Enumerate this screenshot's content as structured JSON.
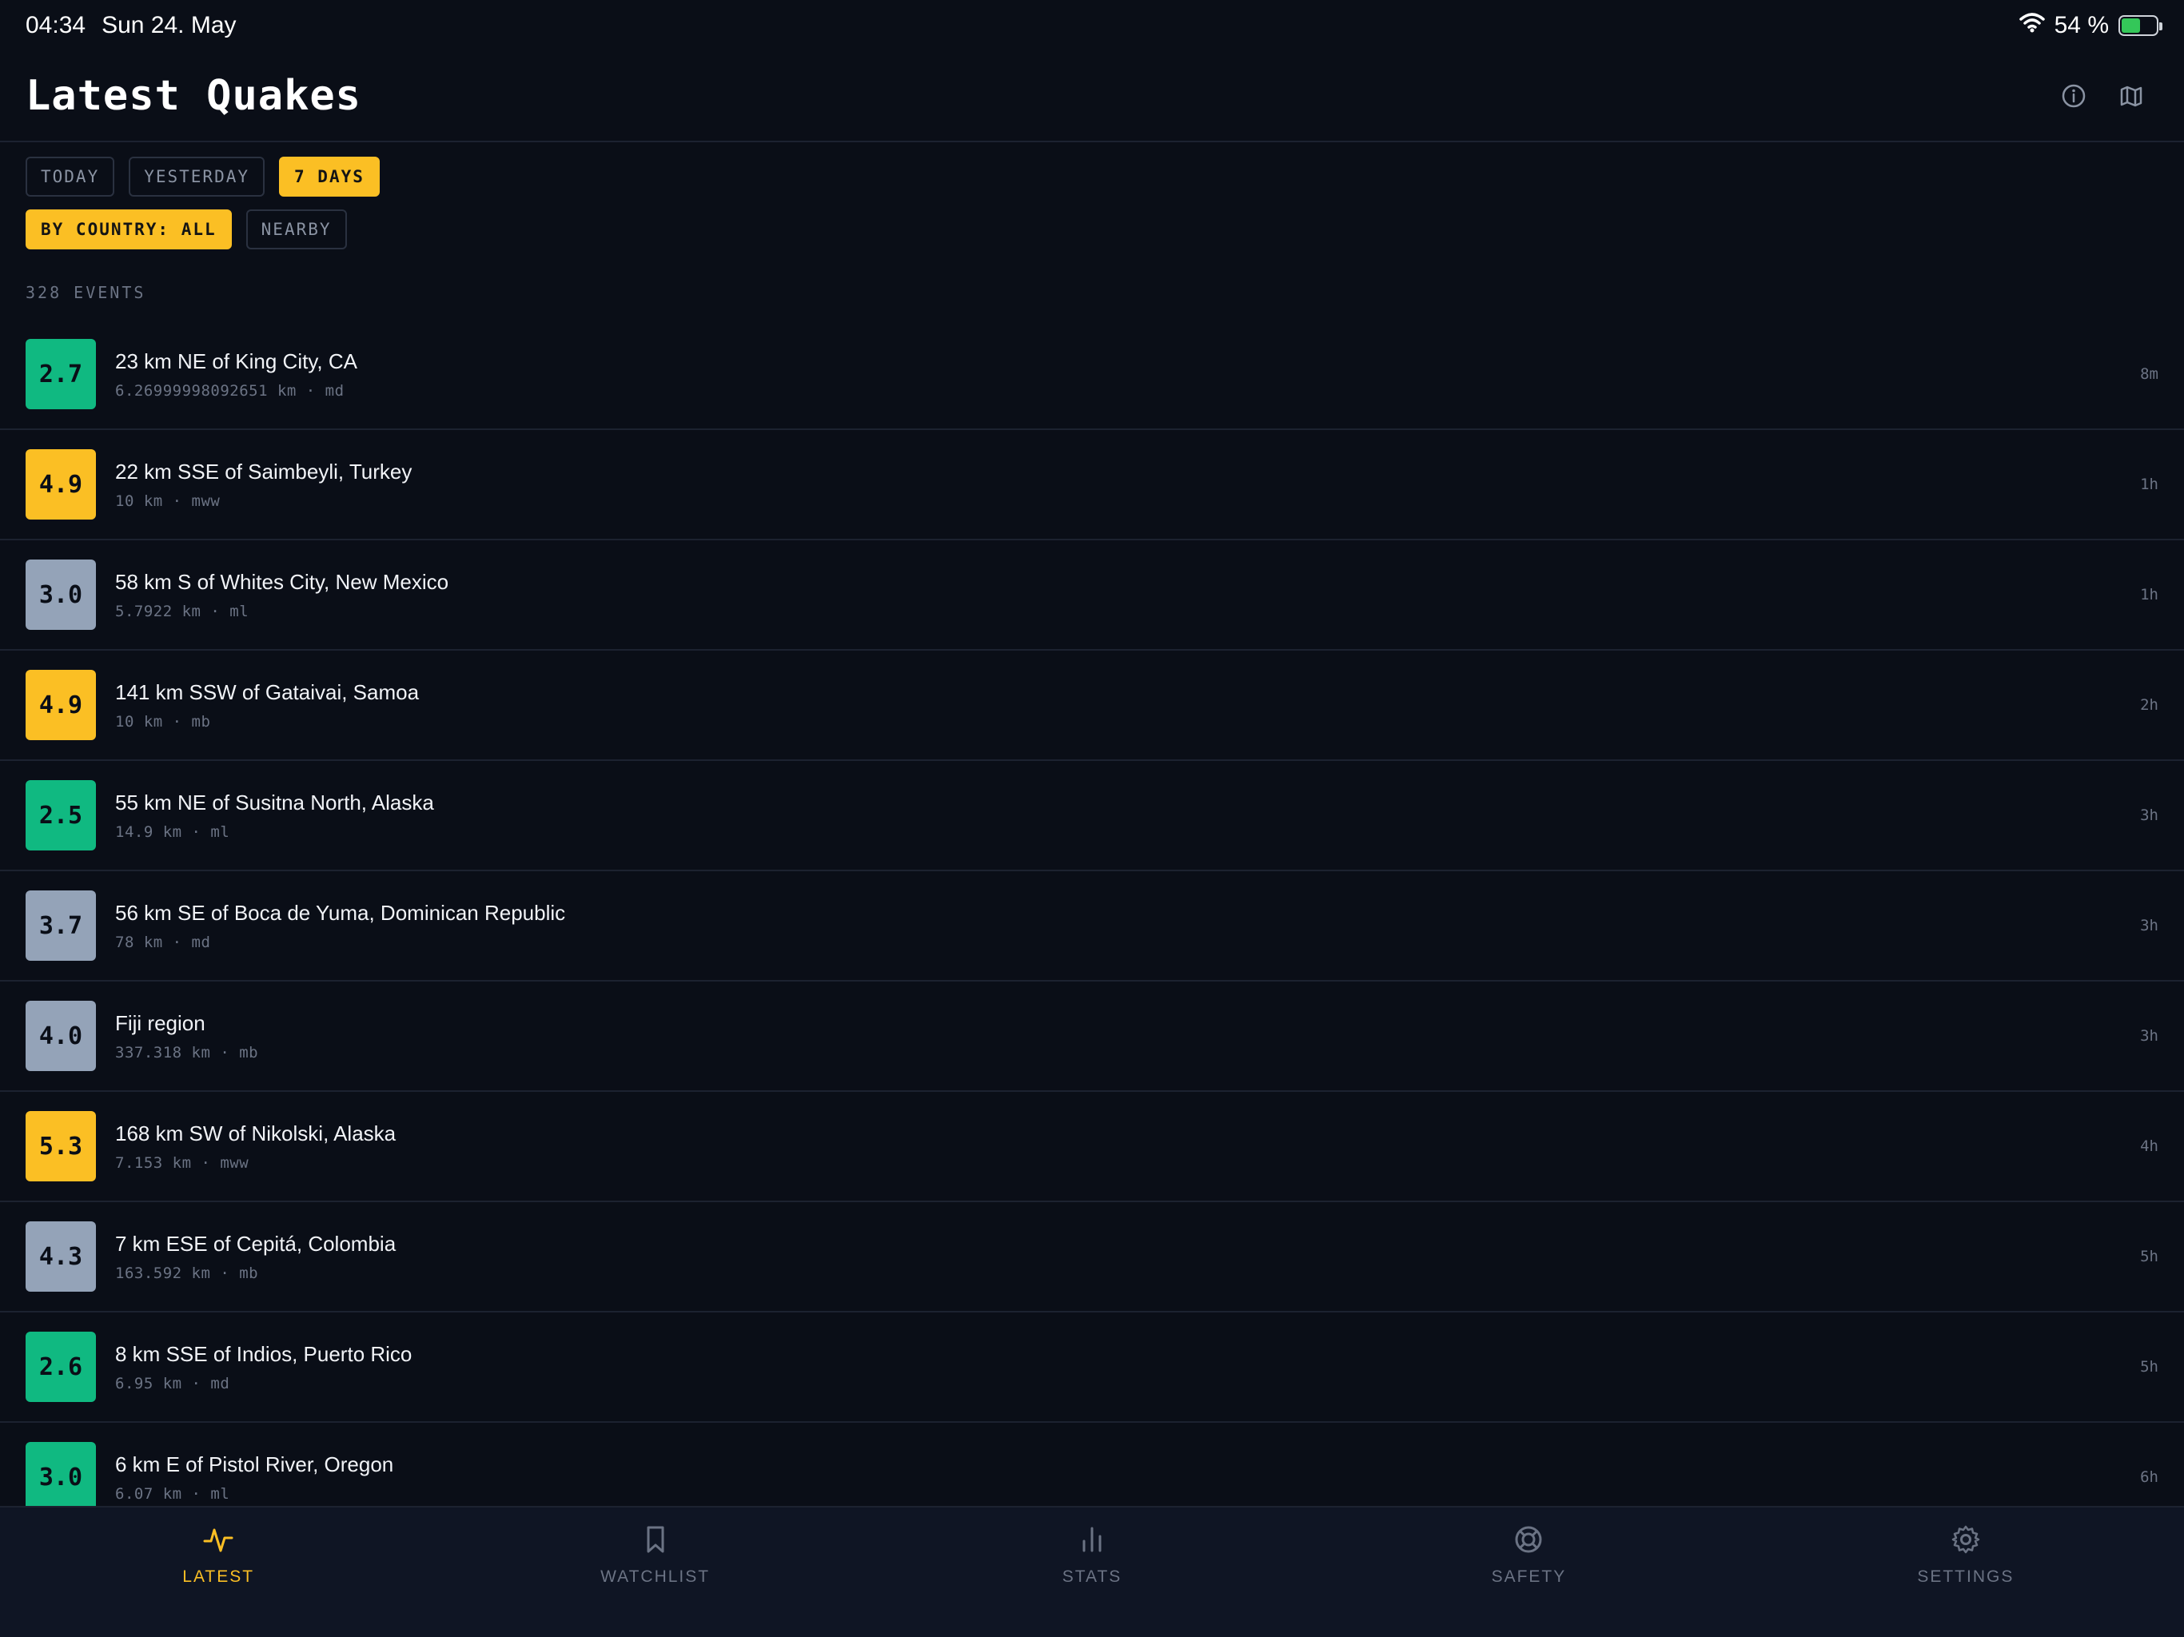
{
  "status": {
    "time": "04:34",
    "date": "Sun 24. May",
    "battery": "54 %",
    "battery_level": 0.54
  },
  "header": {
    "title": "Latest Quakes"
  },
  "filters": {
    "period": [
      {
        "label": "TODAY",
        "active": false
      },
      {
        "label": "YESTERDAY",
        "active": false
      },
      {
        "label": "7 DAYS",
        "active": true
      }
    ],
    "scope": [
      {
        "label": "BY COUNTRY: ALL",
        "active": true
      },
      {
        "label": "NEARBY",
        "active": false
      }
    ]
  },
  "events_count": "328 EVENTS",
  "colors": {
    "low": "#10b981",
    "mid": "#94a3b8",
    "high": "#fbbf24",
    "accent": "#fbbf24"
  },
  "quakes": [
    {
      "mag": "2.7",
      "place": "23 km NE of King City, CA",
      "meta": "6.26999998092651 km · md",
      "time": "8m",
      "level": "low"
    },
    {
      "mag": "4.9",
      "place": "22 km SSE of Saimbeyli, Turkey",
      "meta": "10 km · mww",
      "time": "1h",
      "level": "high"
    },
    {
      "mag": "3.0",
      "place": "58 km S of Whites City, New Mexico",
      "meta": "5.7922 km · ml",
      "time": "1h",
      "level": "mid"
    },
    {
      "mag": "4.9",
      "place": "141 km SSW of Gataivai, Samoa",
      "meta": "10 km · mb",
      "time": "2h",
      "level": "high"
    },
    {
      "mag": "2.5",
      "place": "55 km NE of Susitna North, Alaska",
      "meta": "14.9 km · ml",
      "time": "3h",
      "level": "low"
    },
    {
      "mag": "3.7",
      "place": "56 km SE of Boca de Yuma, Dominican Republic",
      "meta": "78 km · md",
      "time": "3h",
      "level": "mid"
    },
    {
      "mag": "4.0",
      "place": "Fiji region",
      "meta": "337.318 km · mb",
      "time": "3h",
      "level": "mid"
    },
    {
      "mag": "5.3",
      "place": "168 km SW of Nikolski, Alaska",
      "meta": "7.153 km · mww",
      "time": "4h",
      "level": "high"
    },
    {
      "mag": "4.3",
      "place": "7 km ESE of Cepitá, Colombia",
      "meta": "163.592 km · mb",
      "time": "5h",
      "level": "mid"
    },
    {
      "mag": "2.6",
      "place": "8 km SSE of Indios, Puerto Rico",
      "meta": "6.95 km · md",
      "time": "5h",
      "level": "low"
    },
    {
      "mag": "3.0",
      "place": "6 km E of Pistol River, Oregon",
      "meta": "6.07 km · ml",
      "time": "6h",
      "level": "low"
    }
  ],
  "tabs": [
    {
      "label": "LATEST",
      "icon": "activity-icon",
      "active": true
    },
    {
      "label": "WATCHLIST",
      "icon": "bookmark-icon",
      "active": false
    },
    {
      "label": "STATS",
      "icon": "bar-chart-icon",
      "active": false
    },
    {
      "label": "SAFETY",
      "icon": "lifebuoy-icon",
      "active": false
    },
    {
      "label": "SETTINGS",
      "icon": "gear-icon",
      "active": false
    }
  ]
}
